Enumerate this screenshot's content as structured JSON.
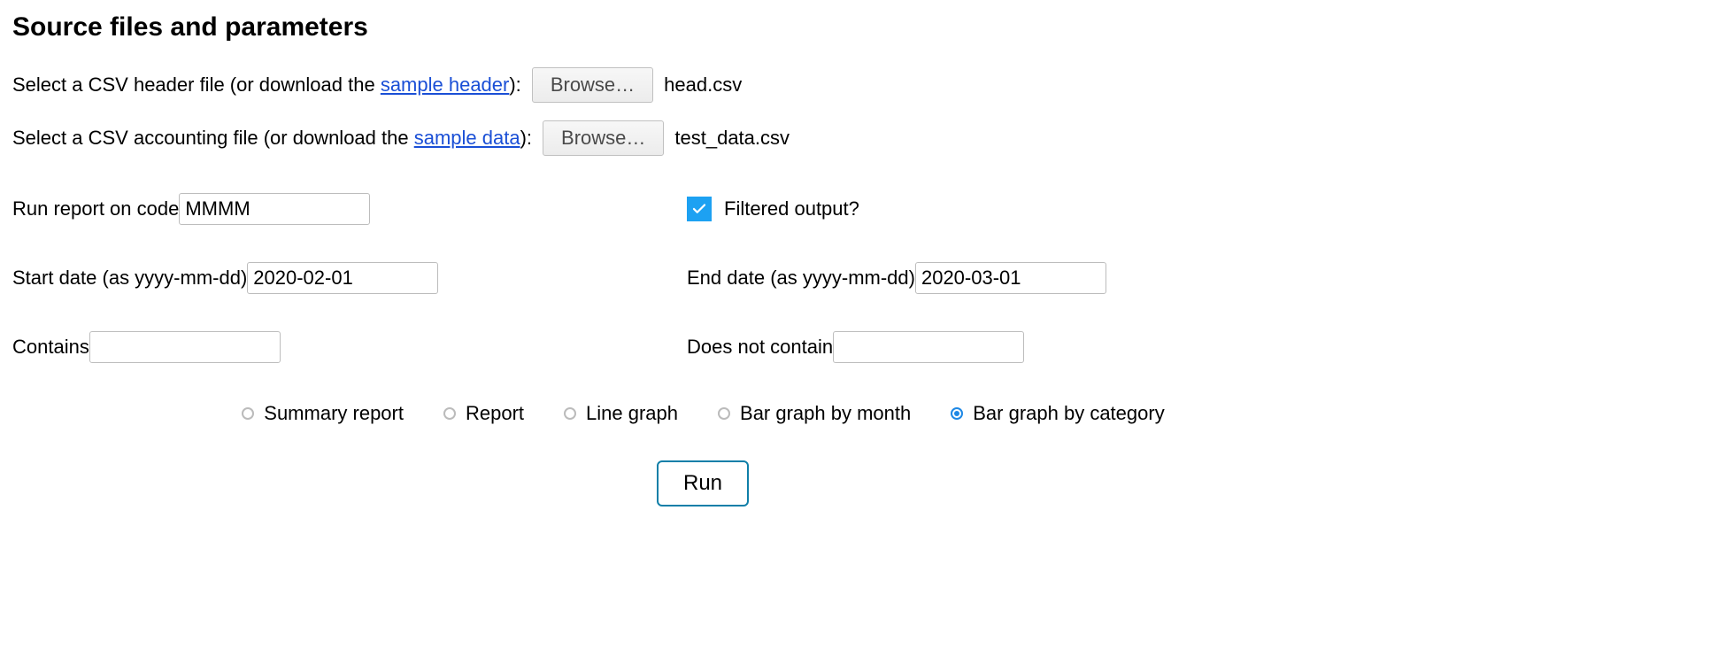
{
  "heading": "Source files and parameters",
  "headerFile": {
    "labelPrefix": "Select a CSV header file (or download the ",
    "linkText": "sample header",
    "labelSuffix": "): ",
    "browseLabel": "Browse…",
    "filename": "head.csv"
  },
  "accountingFile": {
    "labelPrefix": "Select a CSV accounting file (or download the ",
    "linkText": "sample data",
    "labelSuffix": "): ",
    "browseLabel": "Browse…",
    "filename": "test_data.csv"
  },
  "code": {
    "label": "Run report on code ",
    "value": "MMMM"
  },
  "filtered": {
    "label": "Filtered output?",
    "checked": true
  },
  "startDate": {
    "label": "Start date (as yyyy-mm-dd) ",
    "value": "2020-02-01"
  },
  "endDate": {
    "label": "End date (as yyyy-mm-dd) ",
    "value": "2020-03-01"
  },
  "contains": {
    "label": "Contains ",
    "value": ""
  },
  "notContain": {
    "label": "Does not contain ",
    "value": ""
  },
  "reportTypes": {
    "options": [
      {
        "label": "Summary report",
        "selected": false
      },
      {
        "label": "Report",
        "selected": false
      },
      {
        "label": "Line graph",
        "selected": false
      },
      {
        "label": "Bar graph by month",
        "selected": false
      },
      {
        "label": "Bar graph by category",
        "selected": true
      }
    ]
  },
  "runButton": "Run"
}
